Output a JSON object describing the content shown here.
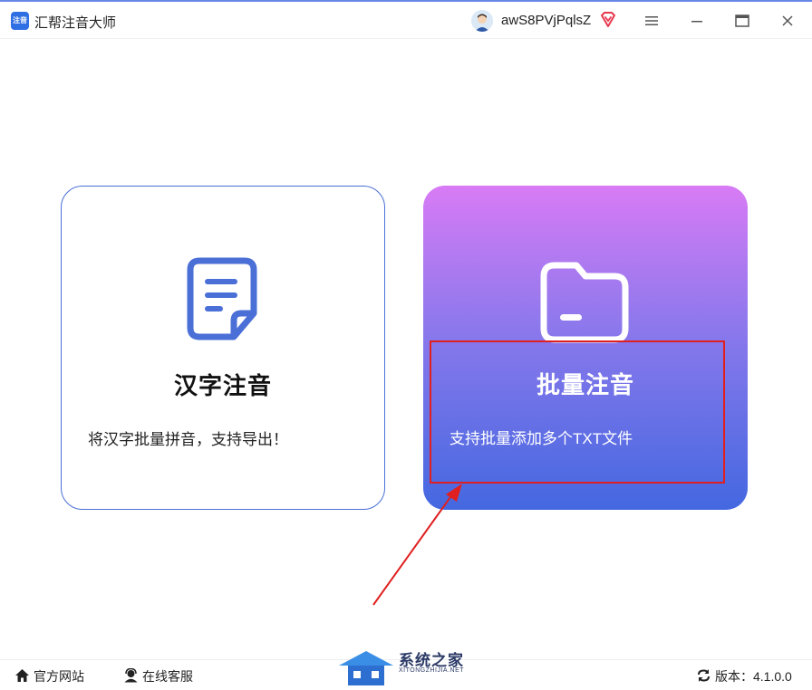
{
  "app": {
    "title": "汇帮注音大师",
    "logo_text": "注音"
  },
  "user": {
    "name": "awS8PVjPqlsZ"
  },
  "window_controls": {
    "menu": "menu-icon",
    "minimize": "minimize-icon",
    "maximize": "maximize-icon",
    "close": "close-icon"
  },
  "cards": [
    {
      "title": "汉字注音",
      "description": "将汉字批量拼音，支持导出！",
      "icon": "document-icon"
    },
    {
      "title": "批量注音",
      "description": "支持批量添加多个TXT文件",
      "icon": "folder-icon"
    }
  ],
  "footer": {
    "website_label": "官方网站",
    "service_label": "在线客服",
    "version_label": "版本：4.1.0.0"
  },
  "watermark": {
    "text": "系统之家",
    "subtext": "XITONGZHIJIA.NET"
  },
  "colors": {
    "accent": "#4a6fd6",
    "gradient_top": "#d87bf5",
    "gradient_bottom": "#4468e0",
    "annotation": "#e02020"
  }
}
